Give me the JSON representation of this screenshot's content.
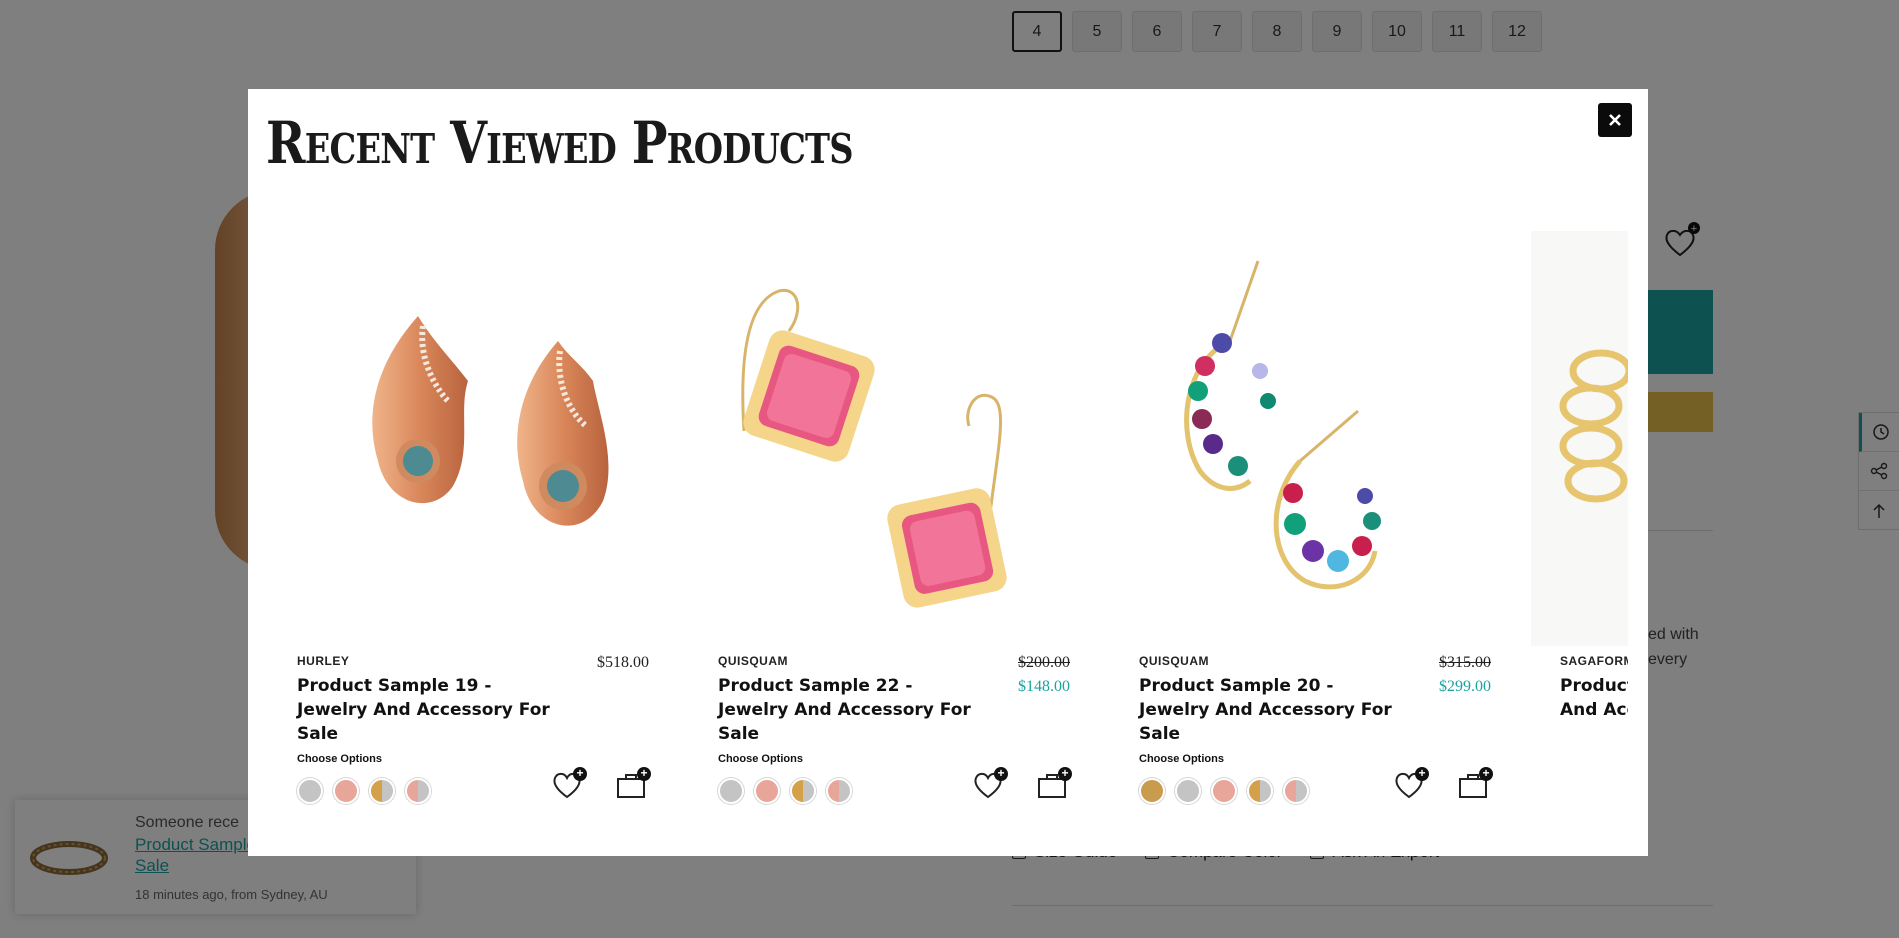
{
  "background": {
    "sizes": [
      "4",
      "5",
      "6",
      "7",
      "8",
      "9",
      "10",
      "11",
      "12"
    ],
    "active_size": "4",
    "description_fragment": [
      "ed with",
      "every"
    ],
    "links": [
      "Size Guide",
      "Compare Color",
      "Ask An Expert"
    ],
    "toast": {
      "prefix": "Someone rece",
      "link": "Product Sample And Accessory For Sale",
      "meta": "18 minutes ago, from Sydney, AU"
    }
  },
  "modal": {
    "title": "Recent Viewed Products",
    "close_icon": "close-icon",
    "choose_label": "Choose Options",
    "products": [
      {
        "brand": "HURLEY",
        "title": "Product Sample 19 - Jewelry And Accessory For Sale",
        "price": "$518.00",
        "old_price": "",
        "swatches": [
          "#c4c4c4",
          "#e8a69a",
          "#d4a04a|#c4c4c4",
          "#e8a69a|#c4c4c4"
        ]
      },
      {
        "brand": "QUISQUAM",
        "title": "Product Sample 22 - Jewelry And Accessory For Sale",
        "price": "$148.00",
        "old_price": "$200.00",
        "swatches": [
          "#c4c4c4",
          "#e8a69a",
          "#d4a04a|#c4c4c4",
          "#e8a69a|#c4c4c4"
        ]
      },
      {
        "brand": "QUISQUAM",
        "title": "Product Sample 20 - Jewelry And Accessory For Sale",
        "price": "$299.00",
        "old_price": "$315.00",
        "swatches": [
          "#c89b4d",
          "#c4c4c4",
          "#e8a69a",
          "#d4a04a|#c4c4c4",
          "#e8a69a|#c4c4c4"
        ]
      },
      {
        "brand": "SAGAFORM",
        "title": "Product Sample - Jewelry And Accessory For Sale",
        "price": "",
        "old_price": "",
        "swatches": []
      }
    ]
  },
  "colors": {
    "accent": "#1aa3a3",
    "gold": "#e9c04a"
  }
}
